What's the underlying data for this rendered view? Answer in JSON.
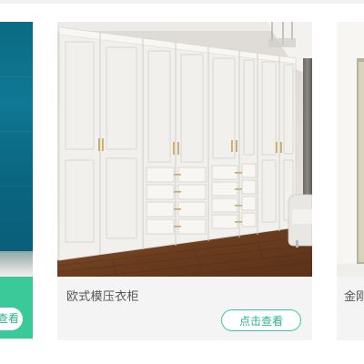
{
  "products": [
    {
      "position": "left-partial",
      "button_label": "点击查看"
    },
    {
      "position": "center",
      "title": "欧式模压衣柜",
      "button_label": "点击查看",
      "image": "white-european-wardrobe-photo"
    },
    {
      "position": "right-partial",
      "title": "金刚"
    }
  ],
  "colors": {
    "accent": "#3cc99a",
    "accent_text": "#2fb386",
    "card_bg": "#f4f4f4",
    "caption_text": "#555555"
  }
}
